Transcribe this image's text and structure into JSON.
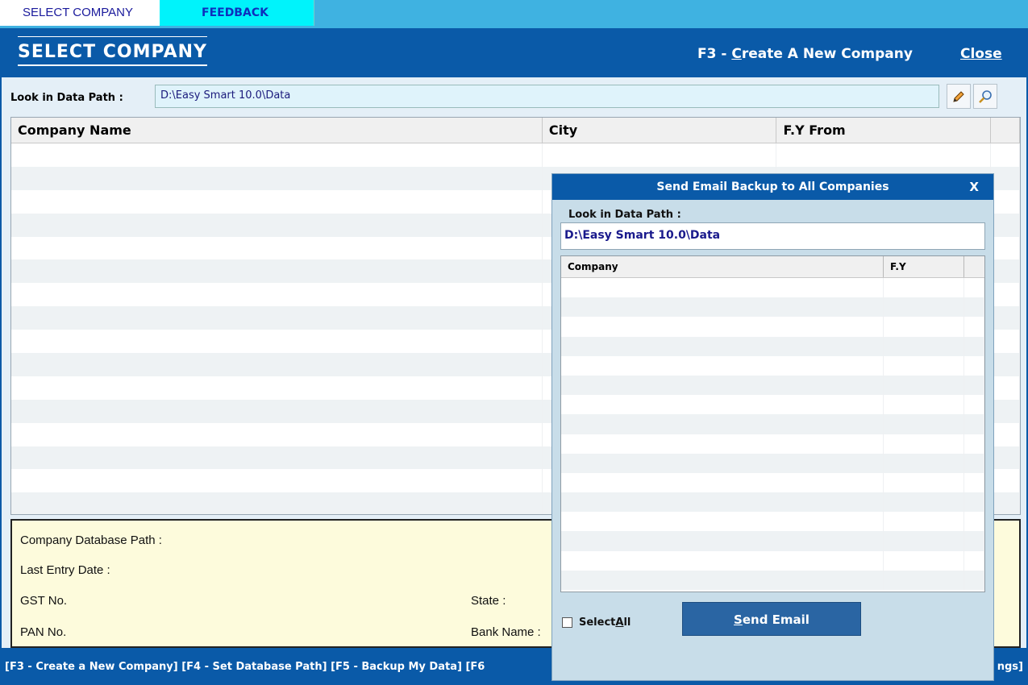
{
  "tabs": {
    "select_company": "SELECT COMPANY",
    "feedback": "FEEDBACK"
  },
  "header": {
    "title": "SELECT COMPANY",
    "create_prefix": "F3 - ",
    "create_accel": "C",
    "create_rest": "reate A New Company",
    "close": "Close"
  },
  "path": {
    "label": "Look in Data Path :",
    "value": "D:\\Easy Smart 10.0\\Data",
    "edit_icon": "pencil-icon",
    "browse_icon": "magnifier-icon"
  },
  "grid": {
    "columns": [
      "Company Name",
      "City",
      "F.Y From",
      ""
    ],
    "rows": []
  },
  "info": {
    "db_path": "Company Database Path :",
    "last_entry": "Last Entry Date :",
    "gst": "GST No.",
    "state": "State :",
    "pan": "PAN No.",
    "bank": "Bank Name :"
  },
  "status": {
    "left": "[F3 - Create a New Company]  [F4 - Set Database Path]  [F5 - Backup My Data]  [F6",
    "right": "ngs]"
  },
  "modal": {
    "title": "Send Email Backup to All Companies",
    "close": "X",
    "path_label": "Look in Data Path :",
    "path_value": "D:\\Easy Smart 10.0\\Data",
    "columns": [
      "Company",
      "F.Y",
      ""
    ],
    "rows": [],
    "select_all_prefix": "Select ",
    "select_all_accel": "A",
    "select_all_rest": "ll",
    "select_all_checked": false,
    "send_accel": "S",
    "send_rest": "end Email"
  },
  "colors": {
    "brand_blue": "#0a5aa8",
    "tab_strip": "#3fb2e1",
    "feedback_tab": "#00f3fb",
    "info_bg": "#fdfbdc"
  }
}
